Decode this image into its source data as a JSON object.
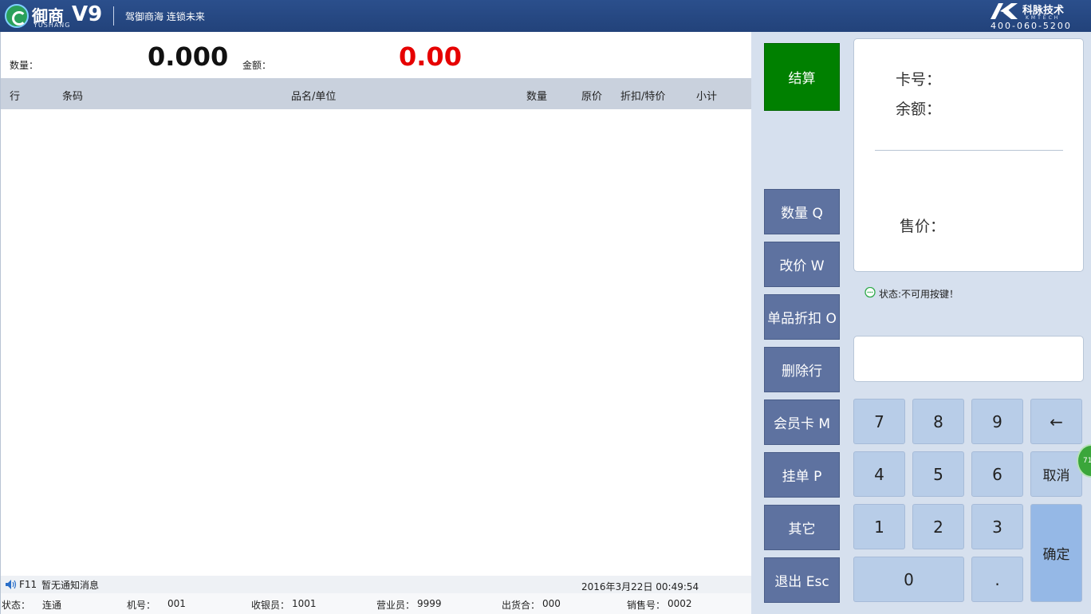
{
  "header": {
    "brand_cn": "御商",
    "brand_en": "YUSHANG",
    "version": "V9",
    "slogan": "驾御商海 连锁未来",
    "partner_name": "科脉技术",
    "partner_sub": "KMTECH",
    "phone": "400-060-5200"
  },
  "summary": {
    "qty_label": "数量：",
    "qty_value": "0.000",
    "amount_label": "金额：",
    "amount_value": "0.00"
  },
  "table": {
    "columns": [
      "行",
      "条码",
      "品名/单位",
      "数量",
      "原价",
      "折扣/特价",
      "小计"
    ],
    "rows": []
  },
  "status_bar": {
    "hotkey": "F11",
    "notice": "暂无通知消息",
    "datetime": "2016年3月22日 00:49:54",
    "state_label": "状态：",
    "state_value": "连通",
    "machine_label": "机号：",
    "machine_value": "001",
    "cashier_label": "收银员：",
    "cashier_value": "1001",
    "clerk_label": "营业员：",
    "clerk_value": "9999",
    "drawer_label": "出货合：",
    "drawer_value": "000",
    "sale_label": "销售号：",
    "sale_value": "0002"
  },
  "function_buttons": {
    "checkout": "结算",
    "quantity": "数量 Q",
    "change_price": "改价 W",
    "item_discount": "单品折扣 O",
    "delete_row": "删除行",
    "member_card": "会员卡 M",
    "hold_order": "挂单 P",
    "other": "其它",
    "exit": "退出 Esc"
  },
  "info_panel": {
    "card_label": "卡号：",
    "balance_label": "余额：",
    "price_label": "售价："
  },
  "key_status": "状态:不可用按键！",
  "keypad": {
    "k7": "7",
    "k8": "8",
    "k9": "9",
    "backspace": "←",
    "k4": "4",
    "k5": "5",
    "k6": "6",
    "cancel": "取消",
    "k1": "1",
    "k2": "2",
    "k3": "3",
    "confirm": "确定",
    "k0": "0",
    "dot": "."
  },
  "side_badge": "71",
  "colors": {
    "header_bg": "#22427a",
    "function_button": "#5e72a0",
    "checkout_button": "#008000",
    "amount_text": "#e60000",
    "keypad_key": "#b8cde8"
  }
}
